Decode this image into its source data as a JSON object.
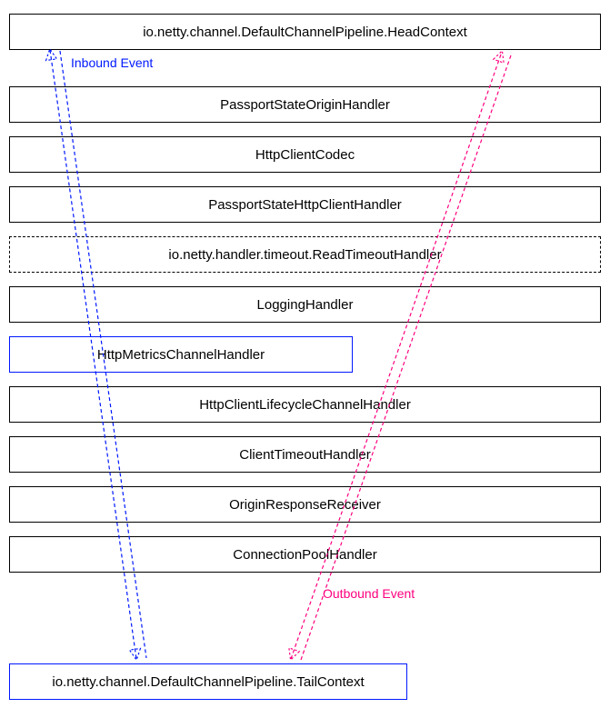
{
  "handlers": {
    "head": "io.netty.channel.DefaultChannelPipeline.HeadContext",
    "passportOrigin": "PassportStateOriginHandler",
    "httpClientCodec": "HttpClientCodec",
    "passportHttp": "PassportStateHttpClientHandler",
    "readTimeout": "io.netty.handler.timeout.ReadTimeoutHandler",
    "logging": "LoggingHandler",
    "metrics": "HttpMetricsChannelHandler",
    "lifecycle": "HttpClientLifecycleChannelHandler",
    "clientTimeout": "ClientTimeoutHandler",
    "originResponse": "OriginResponseReceiver",
    "connectionPool": "ConnectionPoolHandler",
    "tail": "io.netty.channel.DefaultChannelPipeline.TailContext"
  },
  "labels": {
    "inbound": "Inbound Event",
    "outbound": "Outbound Event"
  },
  "colors": {
    "inbound": "#0018ff",
    "outbound": "#ff007f"
  }
}
